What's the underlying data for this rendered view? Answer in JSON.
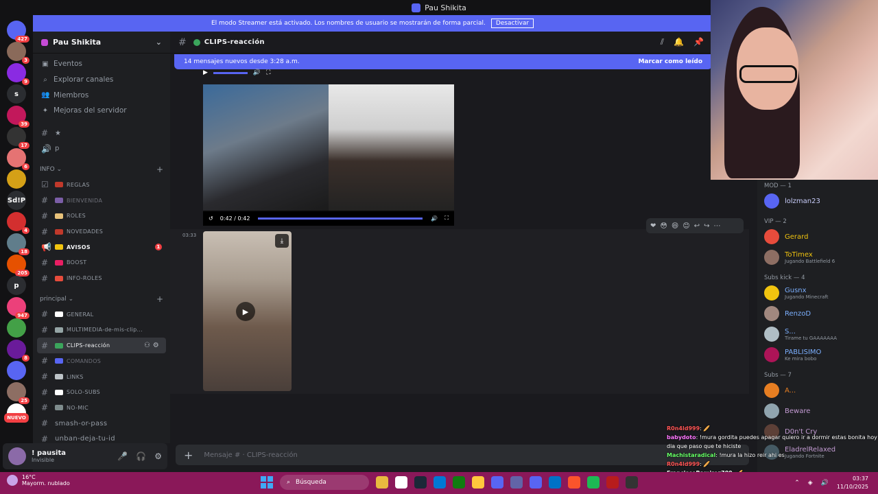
{
  "window": {
    "title": "Pau Shikita"
  },
  "streamer": {
    "text": "El modo Streamer está activado. Los nombres de usuario se mostrarán de forma parcial.",
    "button": "Desactivar"
  },
  "servers": [
    {
      "label": "",
      "badge": "427",
      "color": "#5865f2"
    },
    {
      "label": "",
      "badge": "3",
      "color": "#8a6a5a"
    },
    {
      "label": "",
      "badge": "9",
      "color": "#8a2be2"
    },
    {
      "label": "s",
      "badge": "",
      "color": "#2b2d31"
    },
    {
      "label": "",
      "badge": "39",
      "color": "#c2185b"
    },
    {
      "label": "",
      "badge": "17",
      "color": "#333"
    },
    {
      "label": "",
      "badge": "6",
      "color": "#e57373"
    },
    {
      "label": "",
      "badge": "",
      "color": "#d4a017"
    },
    {
      "label": "Sd!P",
      "badge": "",
      "color": "#2b2d31"
    },
    {
      "label": "",
      "badge": "4",
      "color": "#d32f2f"
    },
    {
      "label": "",
      "badge": "18",
      "color": "#607d8b"
    },
    {
      "label": "",
      "badge": "205",
      "color": "#e65100"
    },
    {
      "label": "p",
      "badge": "",
      "color": "#2b2d31"
    },
    {
      "label": "",
      "badge": "947",
      "color": "#ec407a"
    },
    {
      "label": "",
      "badge": "",
      "color": "#43a047"
    },
    {
      "label": "",
      "badge": "8",
      "color": "#6a1b9a"
    },
    {
      "label": "",
      "badge": "",
      "color": "#5865f2"
    },
    {
      "label": "",
      "badge": "25",
      "color": "#8d6e63"
    },
    {
      "label": "",
      "badge": "",
      "color": "#ffffff"
    }
  ],
  "server_nuevo": "NUEVO",
  "guild": {
    "name": "Pau Shikita",
    "chevron": "⌄"
  },
  "nav": [
    {
      "icon": "▣",
      "label": "Eventos"
    },
    {
      "icon": "⌕",
      "label": "Explorar canales"
    },
    {
      "icon": "👥",
      "label": "Miembros"
    },
    {
      "icon": "✦",
      "label": "Mejoras del servidor"
    }
  ],
  "top_channels": [
    {
      "icon": "#",
      "label": "★"
    },
    {
      "icon": "🔊",
      "label": "p"
    }
  ],
  "categories": {
    "info": {
      "label": "INFO ⌄",
      "plus": "+"
    },
    "principal": {
      "label": "principal ⌄",
      "plus": "+"
    }
  },
  "info_channels": [
    {
      "icon": "☑",
      "emoji": "#c0392b",
      "label": "REGLAS"
    },
    {
      "icon": "#",
      "emoji": "#7b5ea7",
      "label": "BIENVENIDA"
    },
    {
      "icon": "#",
      "emoji": "#e8c27a",
      "label": "ROLES"
    },
    {
      "icon": "#",
      "emoji": "#c0392b",
      "label": "NOVEDADES"
    },
    {
      "icon": "📢",
      "emoji": "#f1c40f",
      "label": "AVISOS",
      "badge": "1"
    },
    {
      "icon": "#",
      "emoji": "#e91e63",
      "label": "BOOST"
    },
    {
      "icon": "#",
      "emoji": "#e74c3c",
      "label": "INFO-ROLES"
    }
  ],
  "principal_channels": [
    {
      "icon": "#",
      "emoji": "#ffffff",
      "label": "GENERAL"
    },
    {
      "icon": "#",
      "emoji": "#95a5a6",
      "label": "MULTIMEDIA-de-mis-clip..."
    },
    {
      "icon": "#",
      "emoji": "#3ba55c",
      "label": "CLIPS-reacción"
    },
    {
      "icon": "#",
      "emoji": "#5865f2",
      "label": "COMANDOS"
    },
    {
      "icon": "#",
      "emoji": "#bdc3c7",
      "label": "LINKS"
    },
    {
      "icon": "#",
      "emoji": "#ffffff",
      "label": "SOLO-SUBS"
    },
    {
      "icon": "#",
      "emoji": "#7f8c8d",
      "label": "NO-MIC"
    },
    {
      "icon": "#",
      "emoji": "",
      "label": "smash-or-pass"
    },
    {
      "icon": "#",
      "emoji": "",
      "label": "unban-deja-tu-id"
    }
  ],
  "active_tools": "⚇ ⚙",
  "user": {
    "name": "! pausita",
    "status": "Invisible",
    "mic": "🎤",
    "headset": "🎧",
    "settings": "⚙"
  },
  "channel": {
    "hash": "#",
    "name": "CLIPS-reacción",
    "toolbar": [
      "⫽",
      "🔔",
      "📌"
    ]
  },
  "newmsgs": {
    "text": "14 mensajes nuevos desde 3:28 a.m.",
    "mark": "Marcar como leído"
  },
  "video1": {
    "time": "0:42 / 0:42"
  },
  "message2": {
    "timestamp": "03:33"
  },
  "reactions": [
    "❤",
    "😳",
    "😄",
    "😊",
    "↩",
    "↪",
    "⋯"
  ],
  "composer": {
    "placeholder": "Mensaje # · CLIPS-reacción",
    "plus": "+"
  },
  "members": {
    "sections": [
      {
        "title": "MOD — 1",
        "people": [
          {
            "name": "lolzman23",
            "activity": "",
            "color": "#c9cdfb",
            "av": "#5865f2"
          }
        ]
      },
      {
        "title": "VIP — 2",
        "people": [
          {
            "name": "Gerard",
            "activity": "",
            "color": "#f1c40f",
            "av": "#e74c3c"
          },
          {
            "name": "ToTimex",
            "activity": "Jugando Battlefield 6",
            "color": "#f1c40f",
            "av": "#8d6e63"
          }
        ]
      },
      {
        "title": "Subs kick — 4",
        "people": [
          {
            "name": "Gusnx",
            "activity": "Jugando Minecraft",
            "color": "#7cb0ff",
            "av": "#f1c40f"
          },
          {
            "name": "RenzoD",
            "activity": "",
            "color": "#7cb0ff",
            "av": "#a1887f"
          },
          {
            "name": "S...",
            "activity": "Tirame tu GAAAAAAA",
            "color": "#7cb0ff",
            "av": "#b0bec5"
          },
          {
            "name": "PABLISIMO",
            "activity": "Ke mira bobo",
            "color": "#7cb0ff",
            "av": "#ad1457"
          }
        ]
      },
      {
        "title": "Subs — 7",
        "people": [
          {
            "name": "A...",
            "activity": "",
            "color": "#e67e22",
            "av": "#e67e22"
          },
          {
            "name": "Beware",
            "activity": "",
            "color": "#c39bd3",
            "av": "#90a4ae"
          },
          {
            "name": "D0n't Cry",
            "activity": "",
            "color": "#c39bd3",
            "av": "#5d4037"
          },
          {
            "name": "EladrelRelaxed",
            "activity": "Jugando Fortnite",
            "color": "#c39bd3",
            "av": "#455a64"
          }
        ]
      }
    ]
  },
  "chat": [
    {
      "user": "R0n4ld999",
      "color": "#ff5555",
      "text": ": 🥖"
    },
    {
      "user": "babydoto",
      "color": "#ff77ff",
      "text": ": !mura gordita puedes apagar quiero ir a dormir estas bonita hoy dia que paso que te hiciste"
    },
    {
      "user": "Machistaradical",
      "color": "#66ff66",
      "text": ": !mura la hizo reir ahi es"
    },
    {
      "user": "R0n4ld999",
      "color": "#ff5555",
      "text": ": 🥖"
    },
    {
      "user": "FranciscoRamirez789",
      "color": "#ffffff",
      "text": ": 🥖"
    },
    {
      "user": "R0n4ld999",
      "color": "#ff5555",
      "text": ": 🥖"
    }
  ],
  "taskbar": {
    "temp": "16°C",
    "weather": "Mayorm. nublado",
    "search": "Búsqueda",
    "time": "03:37",
    "date": "11/10/2025",
    "apps": [
      "#e8b93f",
      "#ffffff",
      "#1b2838",
      "#0078d4",
      "#107c10",
      "#ffc83d",
      "#5865f2",
      "#6264a7",
      "#5865f2",
      "#0072c6",
      "#fb542b",
      "#1db954",
      "#b71c1c",
      "#333333"
    ]
  }
}
